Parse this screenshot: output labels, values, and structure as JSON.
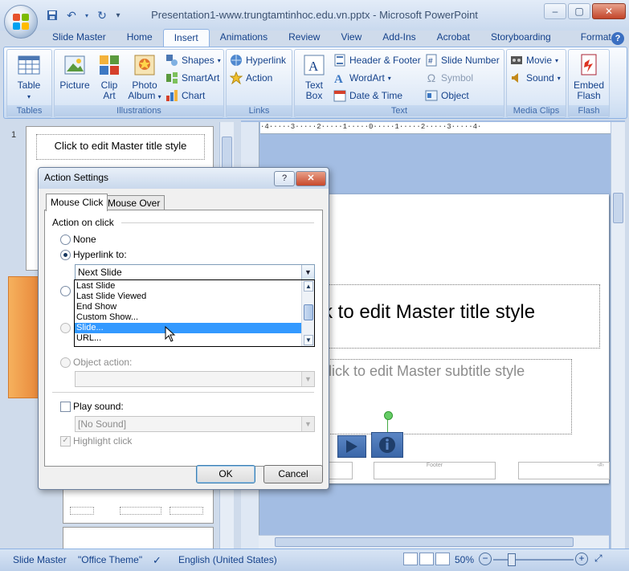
{
  "window": {
    "title_file": "Presentation1-www.trungtamtinhoc.edu.vn.pptx",
    "title_app": "Microsoft PowerPoint",
    "minimize": "–",
    "maximize": "▢",
    "close": "✕"
  },
  "ribbon_tabs": [
    "Slide Master",
    "Home",
    "Insert",
    "Animations",
    "Review",
    "View",
    "Add-Ins",
    "Acrobat",
    "Storyboarding",
    "Format"
  ],
  "active_tab": "Insert",
  "groups": {
    "tables": {
      "label": "Tables",
      "table": "Table"
    },
    "illustrations": {
      "label": "Illustrations",
      "picture": "Picture",
      "clip_art_1": "Clip",
      "clip_art_2": "Art",
      "photo_album_1": "Photo",
      "photo_album_2": "Album",
      "shapes": "Shapes",
      "smartart": "SmartArt",
      "chart": "Chart"
    },
    "links": {
      "label": "Links",
      "hyperlink": "Hyperlink",
      "action": "Action"
    },
    "text": {
      "label": "Text",
      "text_box_1": "Text",
      "text_box_2": "Box",
      "header_footer": "Header & Footer",
      "wordart": "WordArt",
      "date_time": "Date & Time",
      "slide_number": "Slide Number",
      "symbol": "Symbol",
      "object": "Object"
    },
    "media": {
      "label": "Media Clips",
      "movie": "Movie",
      "sound": "Sound"
    },
    "flash": {
      "label": "Flash",
      "embed_1": "Embed",
      "embed_2": "Flash"
    }
  },
  "ruler_text": "·4·····3·····2·····1·····0·····1·····2·····3·····4·",
  "slide_panel": {
    "slide_number": "1",
    "thumb_title": "Click to edit Master title style"
  },
  "slide": {
    "title": "k to edit Master title style",
    "subtitle": "lick to edit Master subtitle style",
    "footer": "Footer",
    "slide_num": "‹#›"
  },
  "dialog": {
    "title": "Action Settings",
    "help": "?",
    "close": "✕",
    "tabs": [
      "Mouse Click",
      "Mouse Over"
    ],
    "section": "Action on click",
    "none": "None",
    "hyperlink_to": "Hyperlink to:",
    "hyperlink_value": "Next Slide",
    "dropdown_items": [
      "Last Slide",
      "Last Slide Viewed",
      "End Show",
      "Custom Show...",
      "Slide...",
      "URL..."
    ],
    "selected_item": "Slide...",
    "object_action": "Object action:",
    "play_sound": "Play sound:",
    "sound_value": "[No Sound]",
    "highlight_click": "Highlight click",
    "ok": "OK",
    "cancel": "Cancel"
  },
  "statusbar": {
    "view": "Slide Master",
    "theme": "\"Office Theme\"",
    "language": "English (United States)",
    "zoom": "50%"
  },
  "colors": {
    "ribbon_blue": "#dbe7f6",
    "highlight": "#3399ff",
    "canvas": "#a3bde3"
  }
}
